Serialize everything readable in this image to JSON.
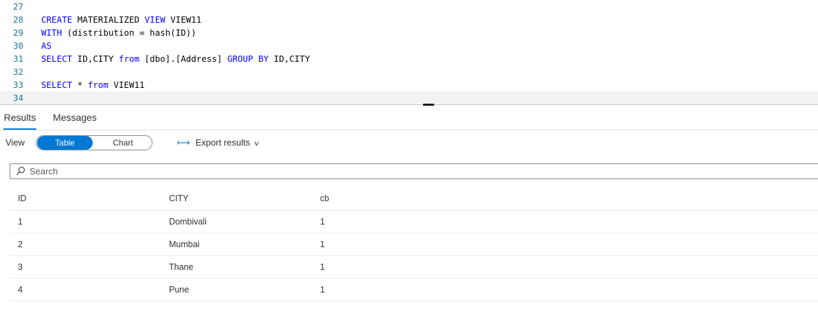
{
  "editor": {
    "lines": [
      {
        "num": "27",
        "tokens": []
      },
      {
        "num": "28",
        "tokens": [
          {
            "t": "CREATE",
            "kw": true
          },
          {
            "t": " MATERIALIZED ",
            "kw": false
          },
          {
            "t": "VIEW",
            "kw": true
          },
          {
            "t": " VIEW11",
            "kw": false
          }
        ]
      },
      {
        "num": "29",
        "tokens": [
          {
            "t": "WITH",
            "kw": true
          },
          {
            "t": " (distribution = hash(ID))",
            "kw": false
          }
        ]
      },
      {
        "num": "30",
        "tokens": [
          {
            "t": "AS",
            "kw": true
          }
        ]
      },
      {
        "num": "31",
        "tokens": [
          {
            "t": "SELECT",
            "kw": true
          },
          {
            "t": " ID,CITY ",
            "kw": false
          },
          {
            "t": "from",
            "kw": true
          },
          {
            "t": " [dbo].[Address] ",
            "kw": false
          },
          {
            "t": "GROUP BY",
            "kw": true
          },
          {
            "t": " ID,CITY",
            "kw": false
          }
        ]
      },
      {
        "num": "32",
        "tokens": []
      },
      {
        "num": "33",
        "tokens": [
          {
            "t": "SELECT",
            "kw": true
          },
          {
            "t": " * ",
            "kw": false
          },
          {
            "t": "from",
            "kw": true
          },
          {
            "t": " VIEW11",
            "kw": false
          }
        ]
      },
      {
        "num": "34",
        "tokens": [],
        "current": true
      }
    ]
  },
  "tabs": {
    "results": "Results",
    "messages": "Messages"
  },
  "toolbar": {
    "view_label": "View",
    "table_label": "Table",
    "chart_label": "Chart",
    "export_label": "Export results"
  },
  "search": {
    "placeholder": "Search"
  },
  "grid": {
    "columns": [
      "ID",
      "CITY",
      "cb"
    ],
    "rows": [
      [
        "1",
        "Dombivali",
        "1"
      ],
      [
        "2",
        "Mumbai",
        "1"
      ],
      [
        "3",
        "Thane",
        "1"
      ],
      [
        "4",
        "Pune",
        "1"
      ]
    ]
  },
  "colors": {
    "accent": "#0078d4",
    "keyword": "#0000ff",
    "line_number": "#237893"
  },
  "icons": {
    "search": "search-icon",
    "export": "export-arrow-icon",
    "dropdown": "chevron-down-icon"
  }
}
